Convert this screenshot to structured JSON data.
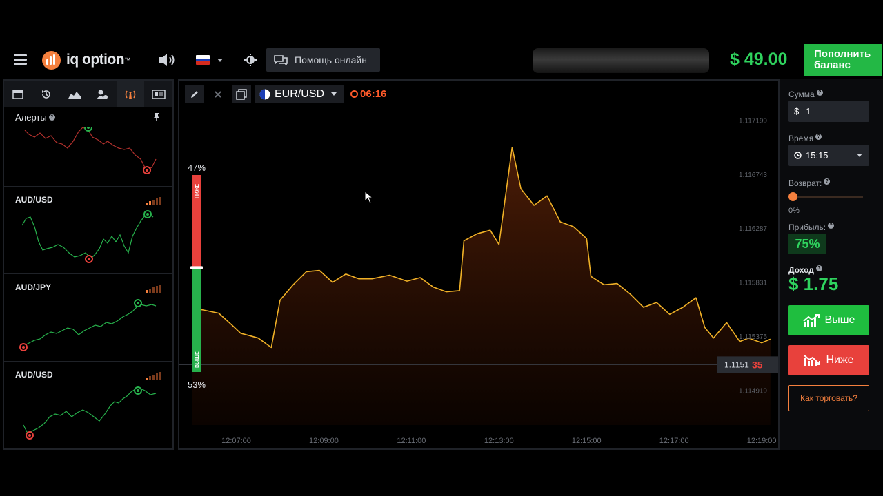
{
  "header": {
    "logo_text": "iq option",
    "logo_tm": "™",
    "help_label": "Помощь онлайн",
    "balance": "$ 49.00",
    "deposit_label": "Пополнить баланс",
    "icons": [
      "menu-icon",
      "speaker-icon",
      "flag-ru-icon",
      "gear-icon",
      "chat-icon"
    ]
  },
  "sidebar": {
    "tabs": [
      "panel-icon",
      "history-icon",
      "chart-icon",
      "users-icon",
      "signal-icon",
      "news-icon"
    ],
    "active_tab": 4,
    "title": "Алерты",
    "help_mark": "?",
    "alerts": [
      {
        "name": "",
        "trend": "down"
      },
      {
        "name": "AUD/USD",
        "trend": "up"
      },
      {
        "name": "AUD/JPY",
        "trend": "up"
      },
      {
        "name": "AUD/USD",
        "trend": "up"
      }
    ]
  },
  "chart": {
    "asset": "EUR/USD",
    "timer": "06:16",
    "pct_down": "47%",
    "pct_up": "53%",
    "label_down": "НИЖЕ",
    "label_up": "ВЫШЕ",
    "current_price_main": "1.1151",
    "current_price_tail": "35",
    "colors": {
      "line": "#f0b127",
      "down": "#e8413c",
      "up": "#27b14c",
      "timer": "#ff5a2a"
    }
  },
  "chart_data": {
    "type": "area",
    "title": "",
    "xlabel": "",
    "ylabel": "",
    "x_ticks": [
      "12:07:00",
      "12:09:00",
      "12:11:00",
      "12:13:00",
      "12:15:00",
      "12:17:00",
      "12:19:00"
    ],
    "y_ticks": [
      "1.117199",
      "1.116743",
      "1.116287",
      "1.115831",
      "1.115375",
      "1.114919"
    ],
    "ylim": [
      1.1148,
      1.1173
    ],
    "series": [
      {
        "values": [
          [
            6.0,
            1.11544
          ],
          [
            6.2,
            1.1156
          ],
          [
            6.6,
            1.11557
          ],
          [
            6.9,
            1.11547
          ],
          [
            7.1,
            1.1154
          ],
          [
            7.3,
            1.11538
          ],
          [
            7.5,
            1.11536
          ],
          [
            7.8,
            1.11528
          ],
          [
            8.0,
            1.11568
          ],
          [
            8.3,
            1.11581
          ],
          [
            8.6,
            1.11592
          ],
          [
            8.9,
            1.11593
          ],
          [
            9.2,
            1.11583
          ],
          [
            9.5,
            1.1159
          ],
          [
            9.8,
            1.11586
          ],
          [
            10.1,
            1.11586
          ],
          [
            10.5,
            1.11589
          ],
          [
            10.9,
            1.11584
          ],
          [
            11.2,
            1.11587
          ],
          [
            11.5,
            1.11579
          ],
          [
            11.8,
            1.11575
          ],
          [
            12.1,
            1.11576
          ],
          [
            12.2,
            1.11618
          ],
          [
            12.5,
            1.11624
          ],
          [
            12.8,
            1.11627
          ],
          [
            13.0,
            1.11615
          ],
          [
            13.3,
            1.11697
          ],
          [
            13.5,
            1.11662
          ],
          [
            13.8,
            1.11648
          ],
          [
            14.1,
            1.11656
          ],
          [
            14.4,
            1.11634
          ],
          [
            14.7,
            1.1163
          ],
          [
            15.0,
            1.1162
          ],
          [
            15.1,
            1.11588
          ],
          [
            15.4,
            1.11581
          ],
          [
            15.7,
            1.11582
          ],
          [
            16.0,
            1.11573
          ],
          [
            16.3,
            1.11562
          ],
          [
            16.6,
            1.11566
          ],
          [
            16.9,
            1.11556
          ],
          [
            17.2,
            1.11562
          ],
          [
            17.5,
            1.1157
          ],
          [
            17.7,
            1.11545
          ],
          [
            17.9,
            1.11536
          ],
          [
            18.2,
            1.11549
          ],
          [
            18.5,
            1.11533
          ],
          [
            18.7,
            1.11536
          ],
          [
            19.0,
            1.11532
          ],
          [
            19.2,
            1.11535
          ]
        ]
      }
    ],
    "current_price": 1.115135,
    "grid": false
  },
  "trade": {
    "amount_label": "Сумма",
    "amount_currency": "$",
    "amount_value": "1",
    "time_label": "Время",
    "time_value": "15:15",
    "return_label": "Возврат:",
    "return_value": "0%",
    "return_level": 0,
    "profit_label": "Прибыль:",
    "profit_value": "75%",
    "income_label": "Доход",
    "income_value": "$ 1.75",
    "up_label": "Выше",
    "down_label": "Ниже",
    "how_label": "Как торговать?",
    "colors": {
      "up": "#1fbe3f",
      "down": "#e8413c",
      "accent": "#f5803e"
    }
  }
}
